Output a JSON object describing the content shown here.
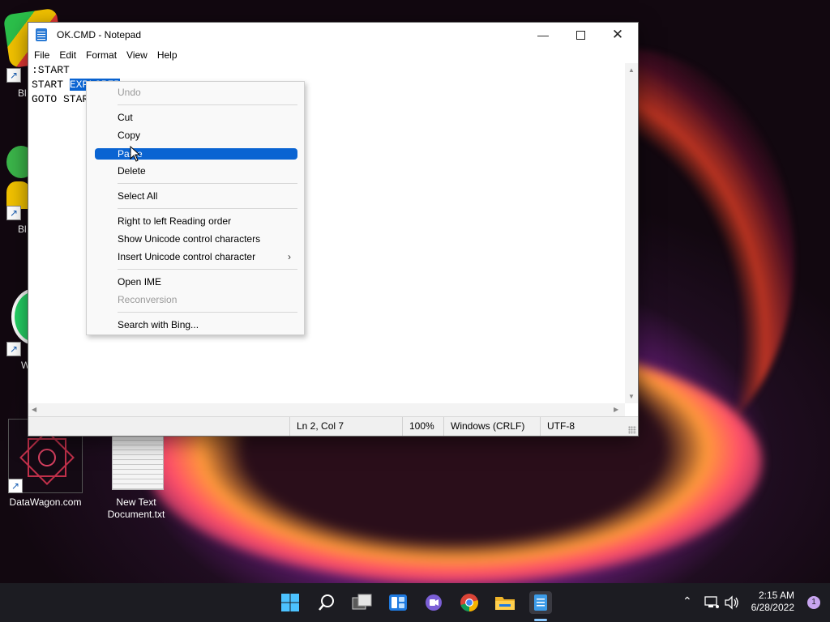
{
  "window": {
    "title": "OK.CMD - Notepad",
    "minimize_icon": "minimize-icon",
    "maximize_icon": "maximize-icon",
    "close_icon": "close-icon"
  },
  "menubar": [
    "File",
    "Edit",
    "Format",
    "View",
    "Help"
  ],
  "editor": {
    "line1": ":START",
    "line2_plain": "START ",
    "line2_selected": "EXPLORER",
    "line3": "GOTO START"
  },
  "context_menu": {
    "undo": "Undo",
    "cut": "Cut",
    "copy": "Copy",
    "paste": "Paste",
    "delete": "Delete",
    "select_all": "Select All",
    "rtl": "Right to left Reading order",
    "show_unicode": "Show Unicode control characters",
    "insert_unicode": "Insert Unicode control character",
    "open_ime": "Open IME",
    "reconversion": "Reconversion",
    "search_bing": "Search with Bing..."
  },
  "statusbar": {
    "position": "Ln 2, Col 7",
    "zoom": "100%",
    "line_ending": "Windows (CRLF)",
    "encoding": "UTF-8"
  },
  "desktop": {
    "icon1_label": "Bl",
    "icon2_label": "Bl",
    "icon3_label": "W",
    "datawagon_label": "DataWagon.com",
    "textdoc_label_1": "New Text",
    "textdoc_label_2": "Document.txt"
  },
  "taskbar": {
    "time": "2:15 AM",
    "date": "6/28/2022",
    "notification_count": "1"
  },
  "colors": {
    "selection": "#0a64d2",
    "taskbar": "#1c1c22"
  }
}
